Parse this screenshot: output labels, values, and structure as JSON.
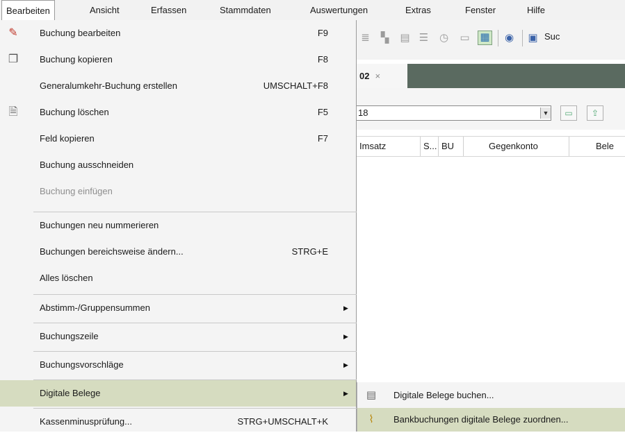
{
  "menubar": {
    "items": [
      {
        "label": "Bearbeiten"
      },
      {
        "label": "Ansicht"
      },
      {
        "label": "Erfassen"
      },
      {
        "label": "Stammdaten"
      },
      {
        "label": "Auswertungen"
      },
      {
        "label": "Extras"
      },
      {
        "label": "Fenster"
      },
      {
        "label": "Hilfe"
      }
    ]
  },
  "menu": {
    "items": [
      {
        "label": "Buchung bearbeiten",
        "shortcut": "F9",
        "icon": "edit-icon"
      },
      {
        "label": "Buchung kopieren",
        "shortcut": "F8",
        "icon": "copy-icon"
      },
      {
        "label": "Generalumkehr-Buchung erstellen",
        "shortcut": "UMSCHALT+F8"
      },
      {
        "label": "Buchung löschen",
        "shortcut": "F5",
        "icon": "delete-icon"
      },
      {
        "label": "Feld kopieren",
        "shortcut": "F7"
      },
      {
        "label": "Buchung ausschneiden"
      },
      {
        "label": "Buchung einfügen",
        "disabled": true
      },
      {
        "label": "Buchungen neu nummerieren"
      },
      {
        "label": "Buchungen bereichsweise ändern...",
        "shortcut": "STRG+E"
      },
      {
        "label": "Alles löschen"
      },
      {
        "label": "Abstimm-/Gruppensummen",
        "submenu": true
      },
      {
        "label": "Buchungszeile",
        "submenu": true
      },
      {
        "label": "Buchungsvorschläge",
        "submenu": true
      },
      {
        "label": "Digitale Belege",
        "submenu": true,
        "highlighted": true
      },
      {
        "label": "Kassenminusprüfung...",
        "shortcut": "STRG+UMSCHALT+K"
      }
    ]
  },
  "submenu": {
    "items": [
      {
        "label": "Digitale Belege buchen...",
        "icon": "document-icon"
      },
      {
        "label": "Bankbuchungen digitale Belege zuordnen...",
        "icon": "paperclip-icon",
        "highlighted": true
      }
    ]
  },
  "background": {
    "toolbar": {
      "search_label": "Suc"
    },
    "tab": {
      "label": "02",
      "close": "×"
    },
    "combo": {
      "value": "18"
    },
    "columns": [
      "Imsatz",
      "S...",
      "BU",
      "Gegenkonto",
      "Bele"
    ]
  },
  "colors": {
    "highlight": "#d6dcc0",
    "menu_bg": "#f4f4f4",
    "tabstrip": "#5a6a60"
  }
}
